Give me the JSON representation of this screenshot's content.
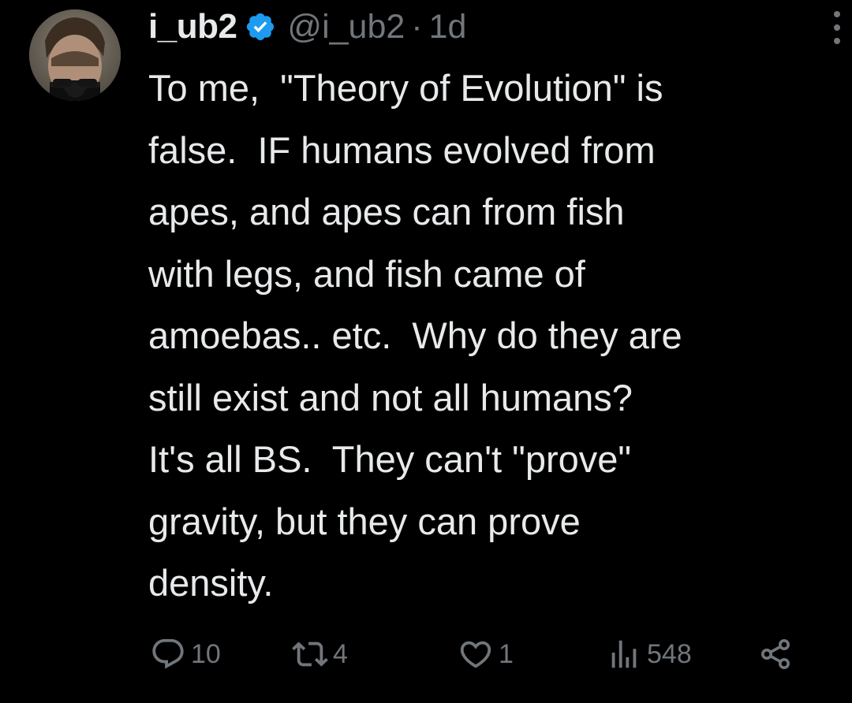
{
  "tweet": {
    "display_name": "i_ub2",
    "handle": "@i_ub2",
    "separator": "·",
    "time": "1d",
    "verified_icon": "verified-badge-icon",
    "lines": [
      "To me,  \"Theory of Evolution\" is",
      "false.  IF humans evolved from",
      "apes, and apes can from fish",
      "with legs, and fish came of",
      "amoebas.. etc.  Why do they are",
      "still exist and not all humans?",
      "It's all BS.  They can't \"prove\"",
      "gravity, but they can prove",
      "density."
    ]
  },
  "actions": {
    "replies": "10",
    "reposts": "4",
    "likes": "1",
    "views": "548",
    "icons": [
      "reply-icon",
      "repost-icon",
      "like-icon",
      "views-icon",
      "share-icon"
    ]
  },
  "colors": {
    "background": "#000000",
    "text": "#e7e9ea",
    "muted": "#71767b",
    "verified": "#1d9bf0"
  }
}
